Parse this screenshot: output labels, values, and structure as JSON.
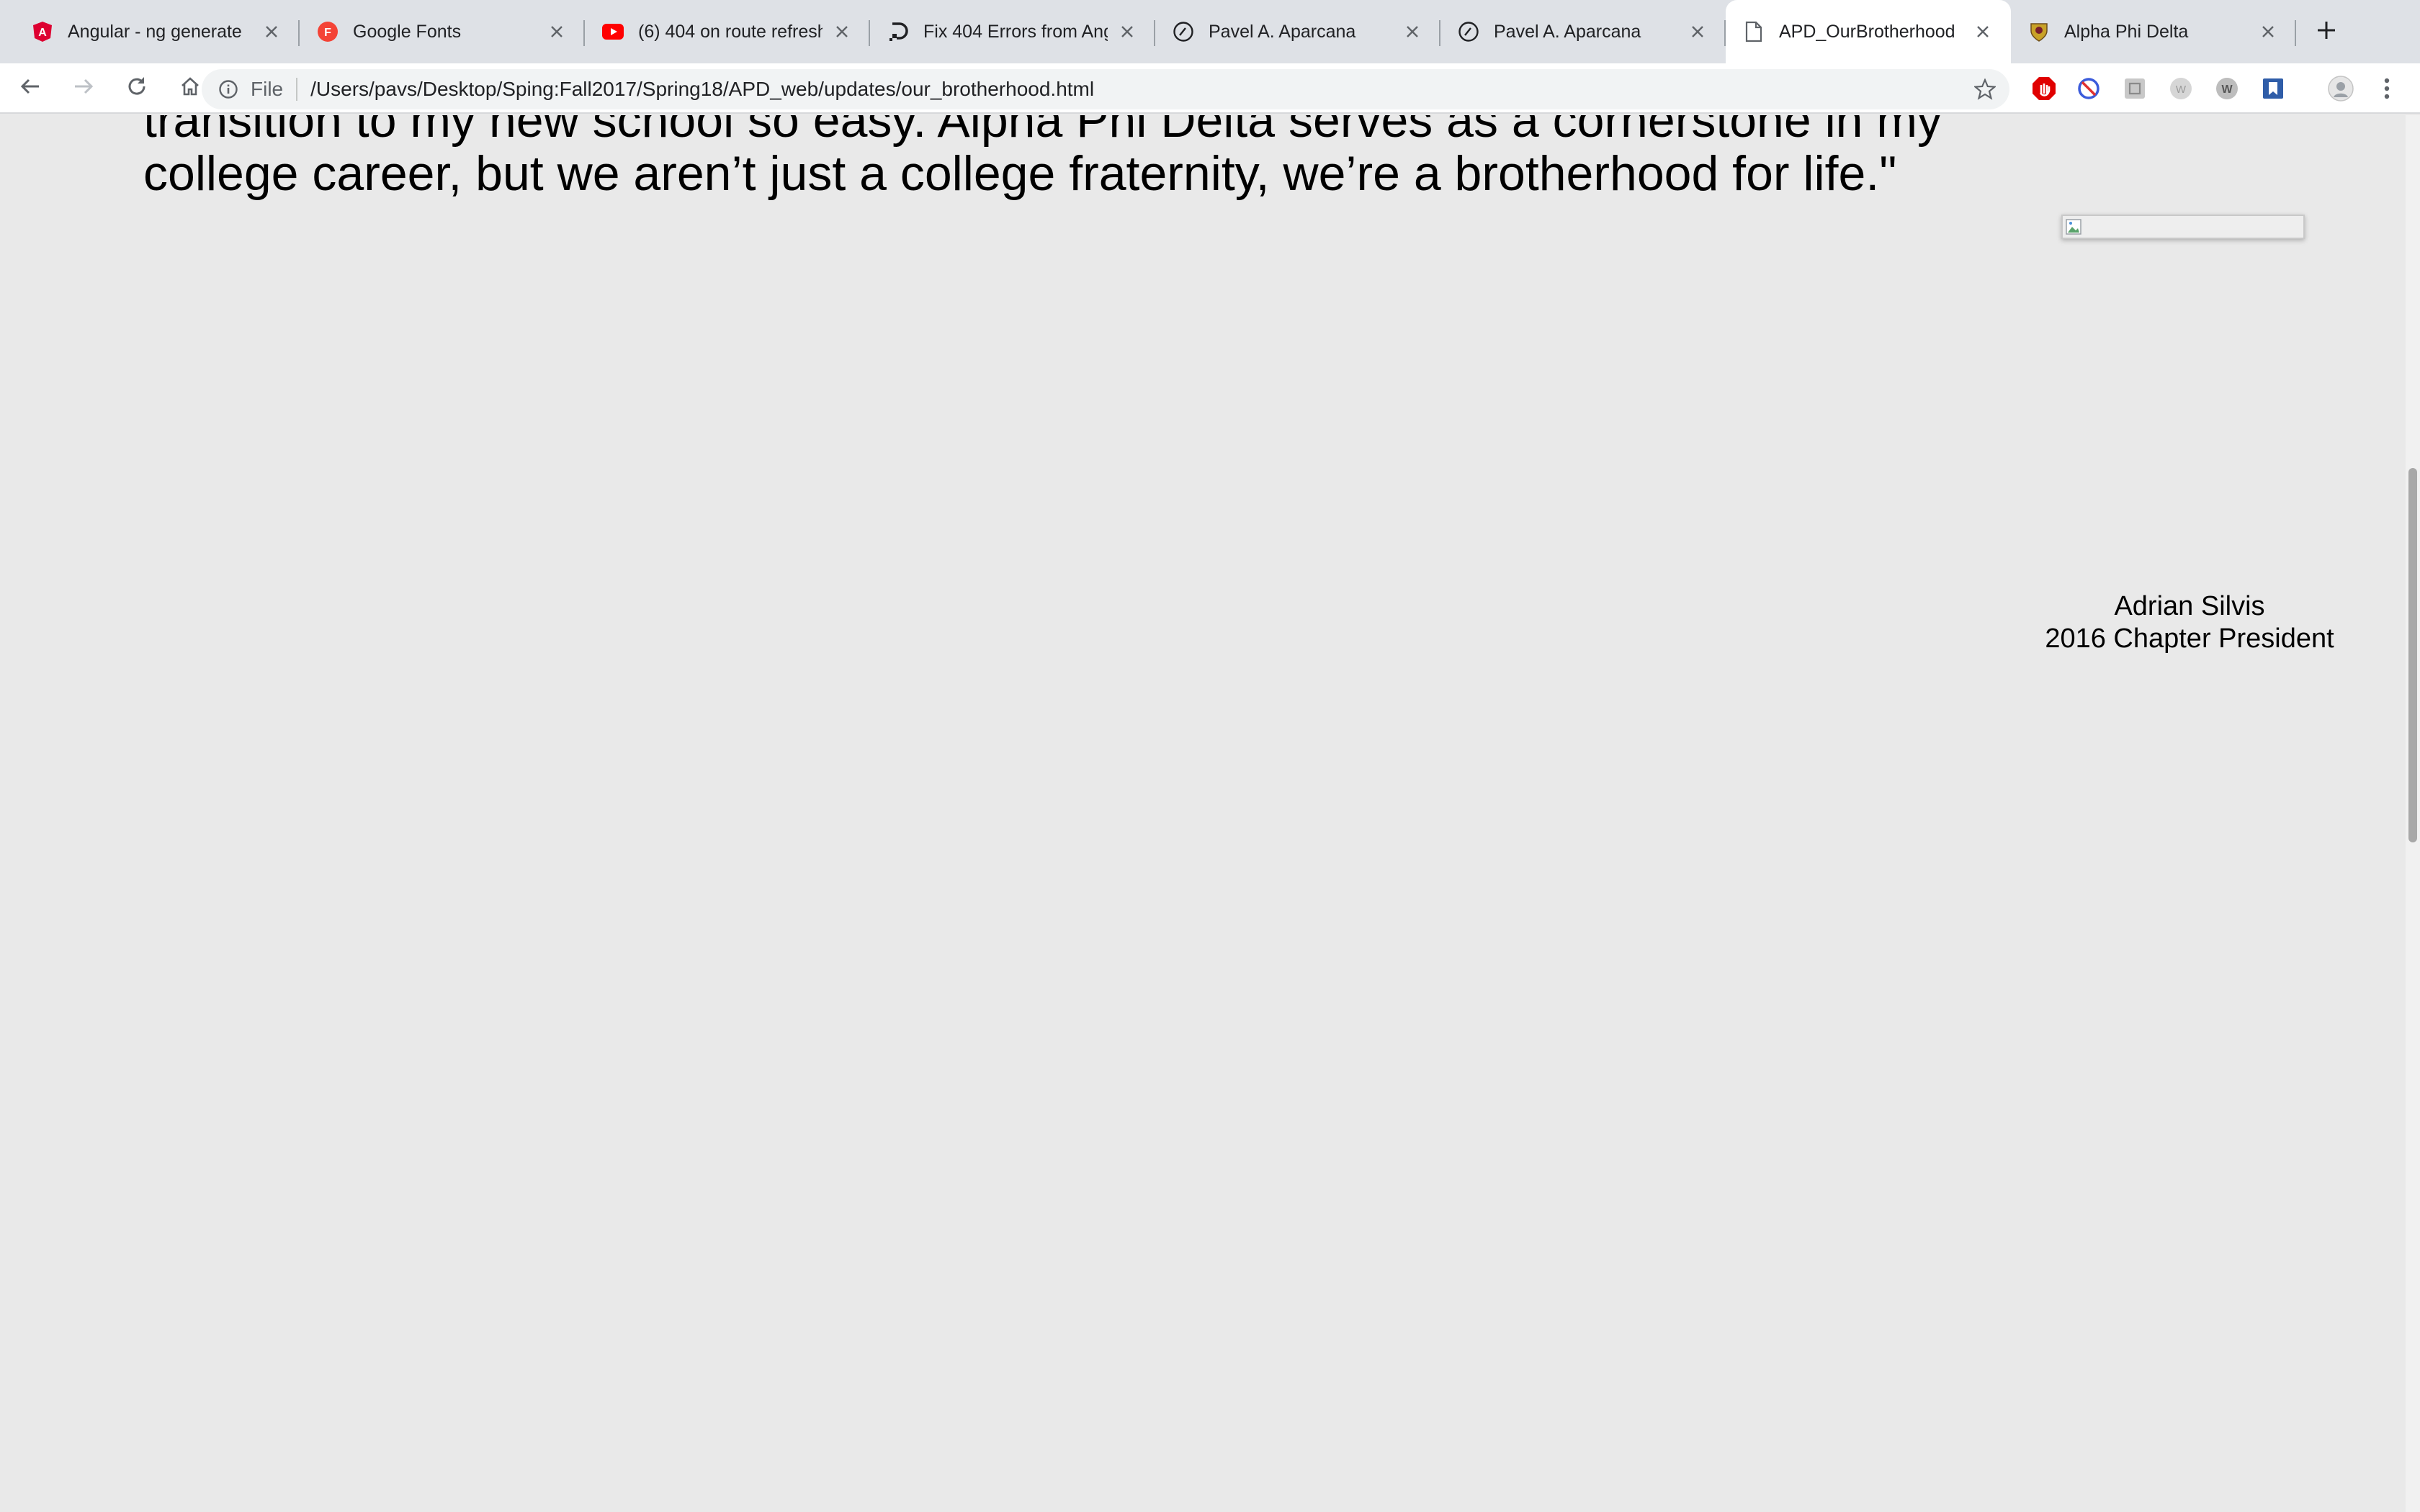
{
  "browser": {
    "tabs": [
      {
        "title": "Angular - ng generate",
        "icon": "angular-icon",
        "color": "#dd0031",
        "active": false
      },
      {
        "title": "Google Fonts",
        "icon": "google-fonts-icon",
        "color": "#f44336",
        "active": false
      },
      {
        "title": "(6) 404 on route refresh",
        "icon": "youtube-icon",
        "color": "#ff0000",
        "active": false
      },
      {
        "title": "Fix 404 Errors from Ang",
        "icon": "digitalocean-icon",
        "color": "#202124",
        "active": false
      },
      {
        "title": "Pavel A. Aparcana",
        "icon": "site-icon",
        "color": "#202124",
        "active": false
      },
      {
        "title": "Pavel A. Aparcana",
        "icon": "site-icon",
        "color": "#202124",
        "active": false
      },
      {
        "title": "APD_OurBrotherhood",
        "icon": "file-icon",
        "color": "#5f6368",
        "active": true
      },
      {
        "title": "Alpha Phi Delta",
        "icon": "crest-icon",
        "color": "#b8860b",
        "active": false
      }
    ],
    "toolbar": {
      "scheme_label": "File",
      "url": "/Users/pavs/Desktop/Sping:Fall2017/Spring18/APD_web/updates/our_brotherhood.html"
    },
    "extensions": [
      "adblock-icon",
      "block-icon",
      "extension-icon",
      "web-extension-icon",
      "w-extension-icon",
      "bookmark-extension-icon",
      "profile-avatar-icon",
      "menu-icon"
    ]
  },
  "page": {
    "quote": "transition to my new school so easy. Alpha Phi Delta serves as a cornerstone in my college career, but we aren’t just a college fraternity, we’re a brotherhood for life.\"",
    "signature": {
      "name": "Adrian Silvis",
      "role": "2016 Chapter President"
    }
  }
}
